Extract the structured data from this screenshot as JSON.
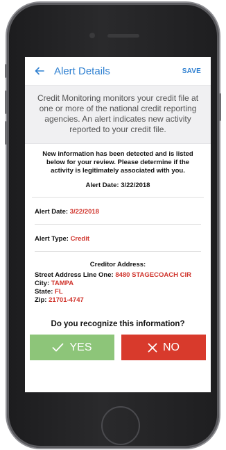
{
  "header": {
    "back_icon": "back-arrow-icon",
    "title": "Alert Details",
    "save_label": "SAVE"
  },
  "intro_text": "Credit Monitoring monitors your credit file at one or more of the national credit reporting agencies. An alert indicates new activity reported to your credit file.",
  "notice": {
    "text": "New information has been detected and is listed below for your review. Please determine if the activity is legitimately associated with you.",
    "alert_date_label": "Alert Date:",
    "alert_date_value": "3/22/2018"
  },
  "details": {
    "alert_date_label": "Alert Date:",
    "alert_date_value": "3/22/2018",
    "alert_type_label": "Alert Type:",
    "alert_type_value": "Credit",
    "creditor_heading": "Creditor Address:",
    "street_label": "Street Address Line One:",
    "street_value": "8480 STAGECOACH CIR",
    "city_label": "City:",
    "city_value": "TAMPA",
    "state_label": "State:",
    "state_value": "FL",
    "zip_label": "Zip:",
    "zip_value": "21701-4747"
  },
  "question": "Do you recognize this information?",
  "actions": {
    "yes_label": "YES",
    "no_label": "NO"
  },
  "colors": {
    "accent": "#2f80d1",
    "yes": "#8dc579",
    "no": "#d83a2c",
    "value_red": "#d0342c"
  }
}
